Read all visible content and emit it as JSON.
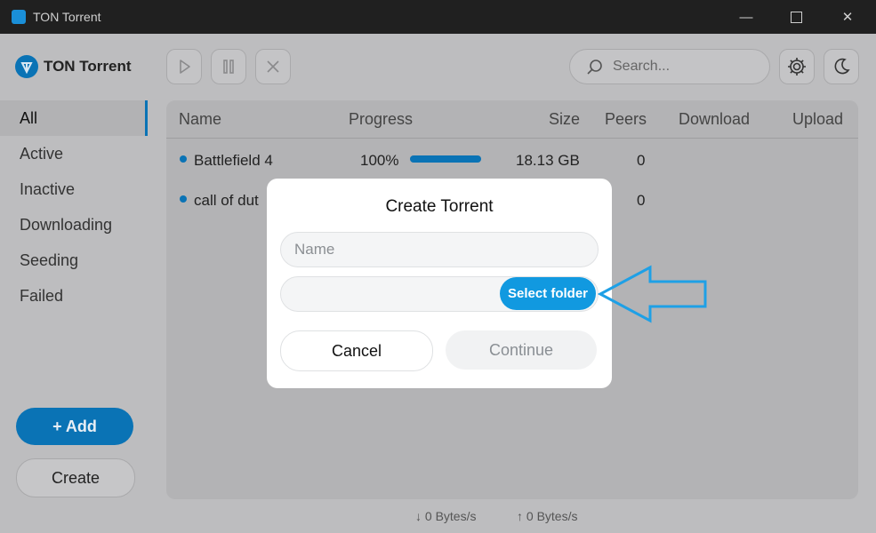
{
  "window": {
    "title": "TON Torrent",
    "controls": [
      "minimize-icon",
      "maximize-icon",
      "close-icon"
    ]
  },
  "logo": {
    "text": "TON Torrent",
    "icon": "ton-logo-icon"
  },
  "toolbar": {
    "buttons": [
      "play-icon",
      "pause-icon",
      "remove-icon"
    ],
    "search_placeholder": "Search...",
    "settings_icon": "gear-icon",
    "theme_icon": "moon-icon"
  },
  "sidebar": {
    "items": [
      {
        "label": "All",
        "active": true
      },
      {
        "label": "Active",
        "active": false
      },
      {
        "label": "Inactive",
        "active": false
      },
      {
        "label": "Downloading",
        "active": false
      },
      {
        "label": "Seeding",
        "active": false
      },
      {
        "label": "Failed",
        "active": false
      }
    ],
    "add_label": "+ Add",
    "create_label": "Create"
  },
  "table": {
    "columns": [
      "Name",
      "Progress",
      "Size",
      "Peers",
      "Download",
      "Upload"
    ],
    "rows": [
      {
        "name": "Battlefield 4",
        "progress": "100%",
        "progress_value": 1.0,
        "size": "18.13 GB",
        "peers": "0",
        "download": "",
        "upload": ""
      },
      {
        "name": "call of dut",
        "progress": "",
        "progress_value": 0,
        "size": "",
        "peers": "0",
        "download": "",
        "upload": ""
      }
    ]
  },
  "status": {
    "download": "↓ 0 Bytes/s",
    "upload": "↑ 0 Bytes/s"
  },
  "modal": {
    "title": "Create Torrent",
    "name_placeholder": "Name",
    "folder_value": "",
    "select_folder_label": "Select folder",
    "cancel_label": "Cancel",
    "continue_label": "Continue"
  },
  "colors": {
    "accent": "#0a73b5",
    "select_folder": "#1199e0",
    "annotation_arrow": "#1ea0e6"
  }
}
